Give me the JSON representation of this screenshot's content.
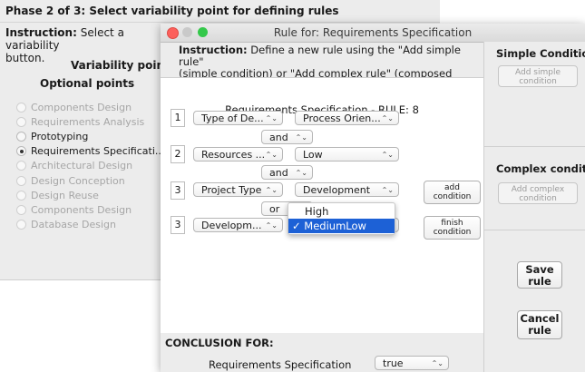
{
  "background": {
    "phase_title": "Phase 2 of 3: Select variability point for defining rules",
    "instruction_bold": "Instruction:",
    "instruction_text": "Select a variability",
    "instruction_line2": "button.",
    "vp_title": "Variability points c",
    "optional_points": "Optional points",
    "points": [
      {
        "label": "Components Design",
        "enabled": false,
        "selected": false
      },
      {
        "label": "Requirements Analysis",
        "enabled": false,
        "selected": false
      },
      {
        "label": "Prototyping",
        "enabled": true,
        "selected": false
      },
      {
        "label": "Requirements Specificati...",
        "enabled": true,
        "selected": true
      },
      {
        "label": "Architectural Design",
        "enabled": false,
        "selected": false
      },
      {
        "label": "Design Conception",
        "enabled": false,
        "selected": false
      },
      {
        "label": "Design Reuse",
        "enabled": false,
        "selected": false
      },
      {
        "label": "Components Design",
        "enabled": false,
        "selected": false
      },
      {
        "label": "Database Design",
        "enabled": false,
        "selected": false
      }
    ]
  },
  "dialog": {
    "title": "Rule for: Requirements Specification",
    "instruction_bold": "Instruction:",
    "instruction_text": "Define a new rule using the \"Add simple rule\"",
    "instruction_line2": "(simple condition) or \"Add complex rule\" (composed condition)",
    "rule_title": "Requirements Specification - RULE: 8",
    "rows": [
      {
        "num": "1",
        "var": "Type of De...",
        "val": "Process Orien..."
      },
      {
        "num": "2",
        "var": "Resources ...",
        "val": "Low"
      },
      {
        "num": "3",
        "var": "Project Type",
        "val": "Development"
      },
      {
        "num": "3",
        "var": "Developm...",
        "val": ""
      }
    ],
    "connectors": [
      "and",
      "and",
      "or"
    ],
    "add_condition": [
      "add",
      "condition"
    ],
    "finish_condition": [
      "finish",
      "condition"
    ],
    "dropdown_options": [
      "High",
      "MediumLow"
    ],
    "dropdown_selected_mark": "✓",
    "conclusion_label": "CONCLUSION FOR:",
    "conclusion_name": "Requirements Specification",
    "conclusion_value": "true",
    "simple_condition_title": "Simple Condition",
    "add_simple": [
      "Add simple",
      "condition"
    ],
    "complex_condition_title": "Complex condition",
    "add_complex": [
      "Add complex",
      "condition"
    ],
    "save_rule": [
      "Save",
      "rule"
    ],
    "cancel_rule": [
      "Cancel",
      "rule"
    ]
  },
  "icons": {
    "stepper": "⌃⌄"
  }
}
